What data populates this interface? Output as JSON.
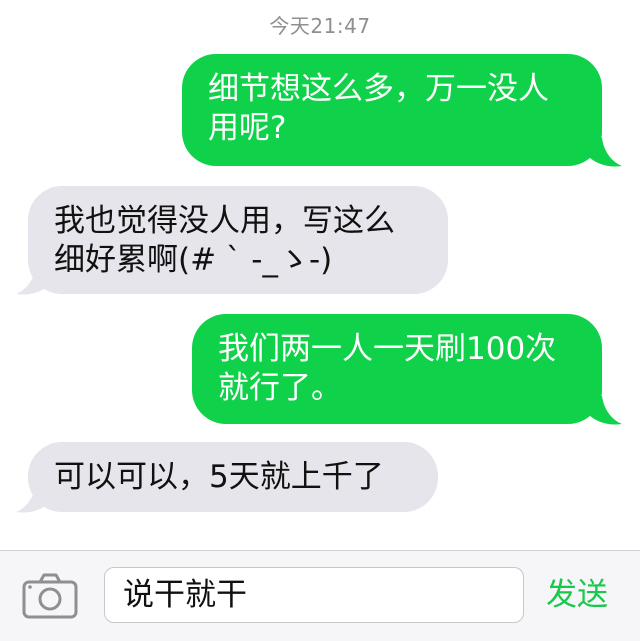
{
  "header": {
    "timestamp": "今天21:47"
  },
  "messages": [
    {
      "direction": "outgoing",
      "text": "细节想这么多，万一没人\n用呢?"
    },
    {
      "direction": "incoming",
      "text": "我也觉得没人用，写这么\n细好累啊(# ` -_ゝ-)"
    },
    {
      "direction": "outgoing",
      "text": "我们两一人一天刷100次\n就行了。"
    },
    {
      "direction": "incoming",
      "text": "可以可以，5天就上千了"
    }
  ],
  "composer": {
    "input_value": "说干就干",
    "send_label": "发送",
    "camera_icon": "camera-icon"
  },
  "colors": {
    "outgoing_bubble": "#10d24a",
    "incoming_bubble": "#e6e5eb",
    "send_text": "#18c84a",
    "timestamp_text": "#8e8e93"
  }
}
